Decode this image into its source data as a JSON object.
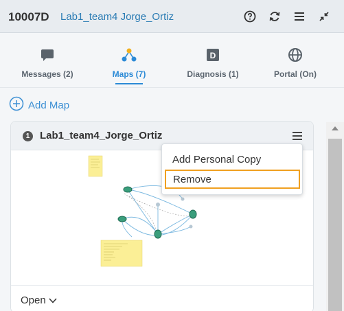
{
  "header": {
    "device_id": "10007D",
    "team_name": "Lab1_team4 Jorge_Ortiz",
    "icons": [
      "help-icon",
      "refresh-icon",
      "menu-icon",
      "collapse-icon"
    ]
  },
  "tabs": [
    {
      "label": "Messages (2)",
      "icon": "message-icon",
      "active": false
    },
    {
      "label": "Maps (7)",
      "icon": "map-icon",
      "active": true
    },
    {
      "label": "Diagnosis (1)",
      "icon": "diagnosis-icon",
      "active": false
    },
    {
      "label": "Portal (On)",
      "icon": "globe-icon",
      "active": false
    }
  ],
  "add_map": {
    "label": "Add Map",
    "icon": "plus-circle-icon"
  },
  "map_card": {
    "number": "1",
    "title": "Lab1_team4_Jorge_Ortiz",
    "open_label": "Open",
    "menu_icon": "hamburger-icon"
  },
  "menu": {
    "items": [
      "Add Personal Copy",
      "Remove"
    ],
    "highlighted": "Remove"
  },
  "colors": {
    "accent": "#2b8ad6",
    "highlight_border": "#f0a020",
    "header_bg": "#e8ecf0"
  }
}
